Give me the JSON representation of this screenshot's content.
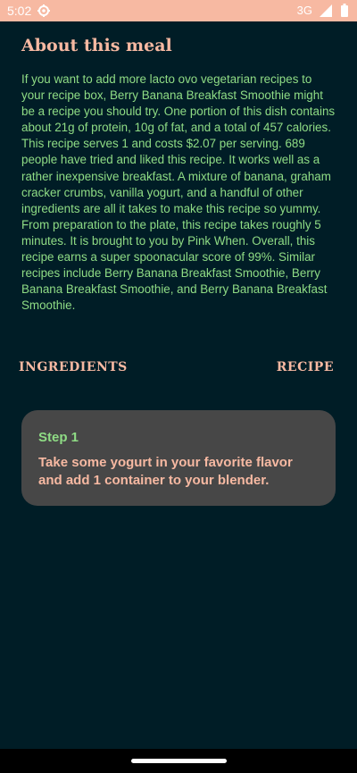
{
  "status_bar": {
    "time": "5:02",
    "network": "3G",
    "icons": [
      "gear-icon",
      "signal-icon",
      "battery-icon"
    ]
  },
  "meal": {
    "title": "About this meal",
    "summary": "If you want to add more lacto ovo vegetarian recipes to your recipe box, Berry Banana Breakfast Smoothie might be a recipe you should try. One portion of this dish contains about 21g of protein, 10g of fat, and a total of 457 calories. This recipe serves 1 and costs $2.07 per serving. 689 people have tried and liked this recipe. It works well as a rather inexpensive breakfast. A mixture of banana, graham cracker crumbs, vanilla yogurt, and a handful of other ingredients are all it takes to make this recipe so yummy. From preparation to the plate, this recipe takes roughly 5 minutes. It is brought to you by Pink When. Overall, this recipe earns a super spoonacular score of 99%. Similar recipes include Berry Banana Breakfast Smoothie, Berry Banana Breakfast Smoothie, and Berry Banana Breakfast Smoothie."
  },
  "tabs": {
    "ingredients": "INGREDIENTS",
    "recipe": "RECIPE"
  },
  "step": {
    "title": "Step 1",
    "text": "Take some yogurt in your favorite flavor and add 1 container to your blender."
  },
  "colors": {
    "background": "#001d26",
    "status_bar": "#f7b9a2",
    "accent_peach": "#f7b9a2",
    "accent_green": "#8fdc85",
    "card": "#474747"
  }
}
